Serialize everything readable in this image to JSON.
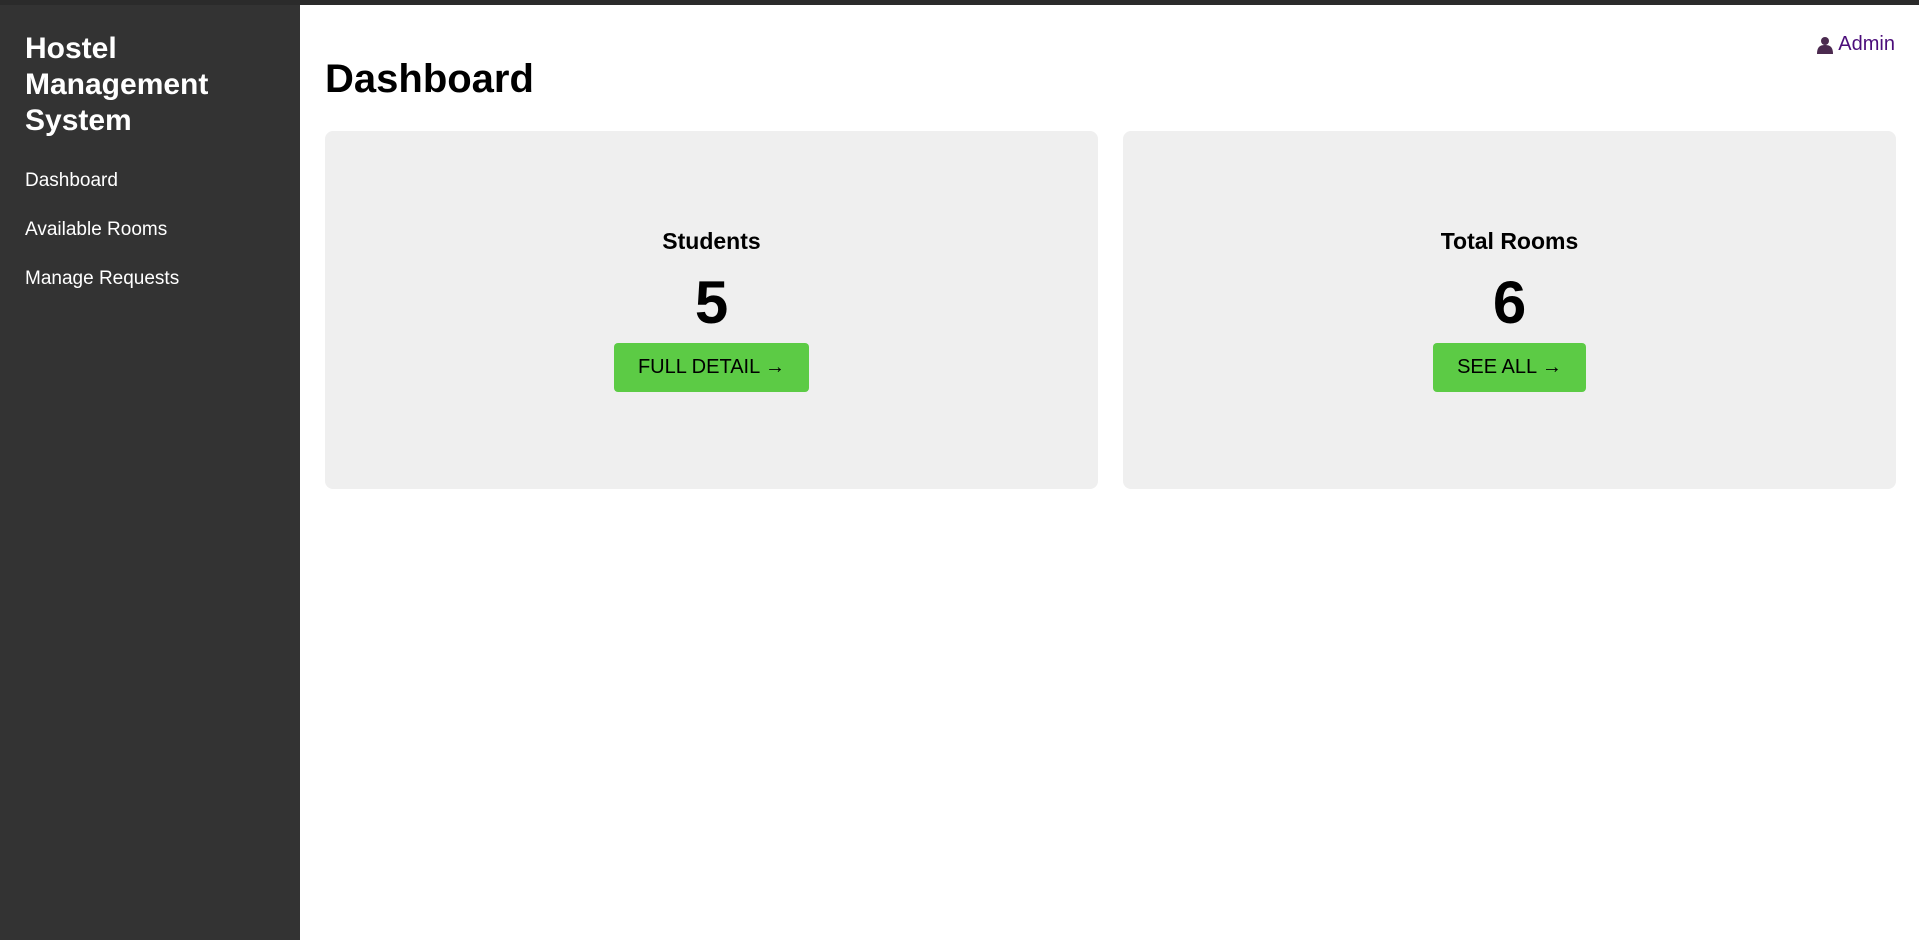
{
  "sidebar": {
    "brand": "Hostel Management System",
    "items": [
      {
        "label": "Dashboard"
      },
      {
        "label": "Available Rooms"
      },
      {
        "label": "Manage Requests"
      }
    ]
  },
  "header": {
    "user_label": "Admin",
    "user_icon": "user-icon"
  },
  "main": {
    "title": "Dashboard",
    "cards": [
      {
        "title": "Students",
        "count": "5",
        "button_label": "FULL DETAIL →"
      },
      {
        "title": "Total Rooms",
        "count": "6",
        "button_label": "SEE ALL →"
      }
    ]
  },
  "colors": {
    "sidebar_bg": "#333333",
    "card_bg": "#efefef",
    "button_bg": "#5ccb45",
    "admin_link": "#4b0d7a"
  }
}
